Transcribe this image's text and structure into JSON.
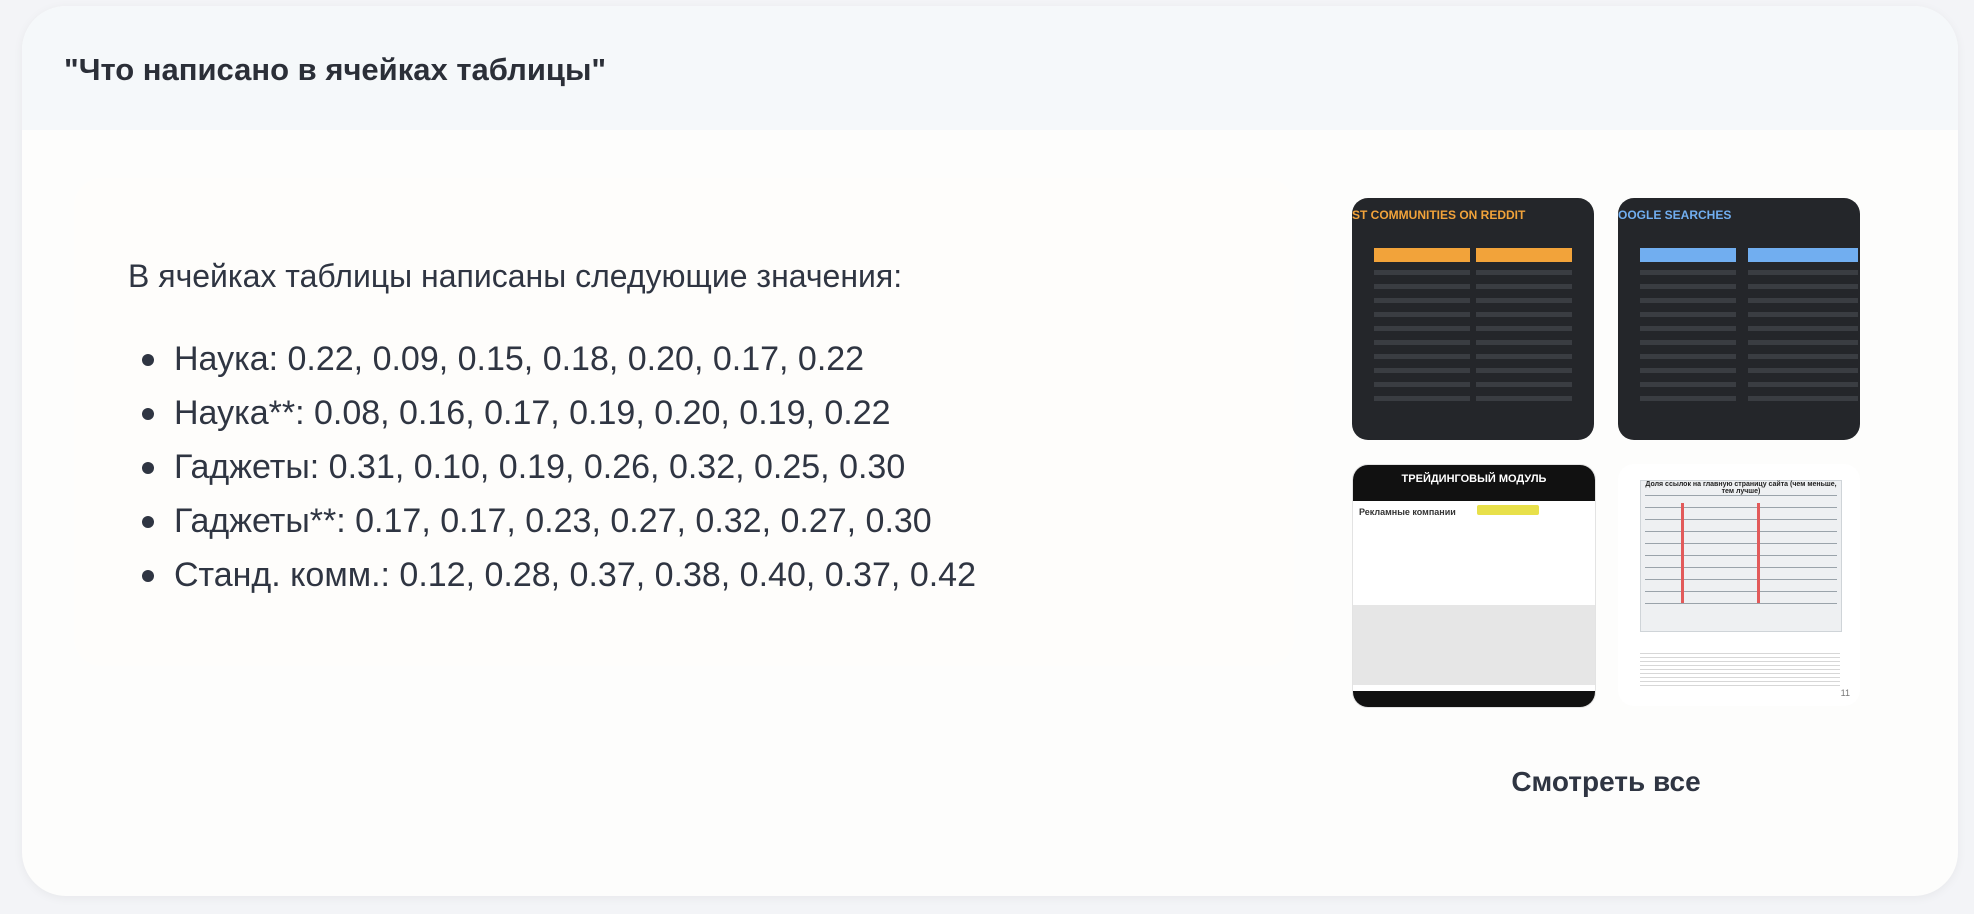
{
  "question": {
    "title": "\"Что написано в ячейках таблицы\""
  },
  "answer": {
    "lead": "В ячейках таблицы написаны следующие значения:",
    "items": [
      "Наука: 0.22, 0.09, 0.15, 0.18, 0.20, 0.17, 0.22",
      "Наука**: 0.08, 0.16, 0.17, 0.19, 0.20, 0.19, 0.22",
      "Гаджеты: 0.31, 0.10, 0.19, 0.26, 0.32, 0.25, 0.30",
      "Гаджеты**: 0.17, 0.17, 0.23, 0.27, 0.32, 0.27, 0.30",
      "Станд. комм.: 0.12, 0.28, 0.37, 0.38, 0.40, 0.37, 0.42"
    ]
  },
  "sources": {
    "thumbnails": [
      {
        "title": "ST COMMUNITIES ON REDDIT",
        "accent": "#f2a33a"
      },
      {
        "title": "OOGLE SEARCHES",
        "accent": "#71aef0"
      },
      {
        "title": "ТРЕЙДИНГОВЫЙ МОДУЛЬ",
        "subtitle": "Рекламные компании"
      },
      {
        "title": "Доля ссылок на главную страницу сайта (чем меньше, тем лучше)",
        "page_number": "11"
      }
    ],
    "see_all_label": "Смотреть все"
  }
}
